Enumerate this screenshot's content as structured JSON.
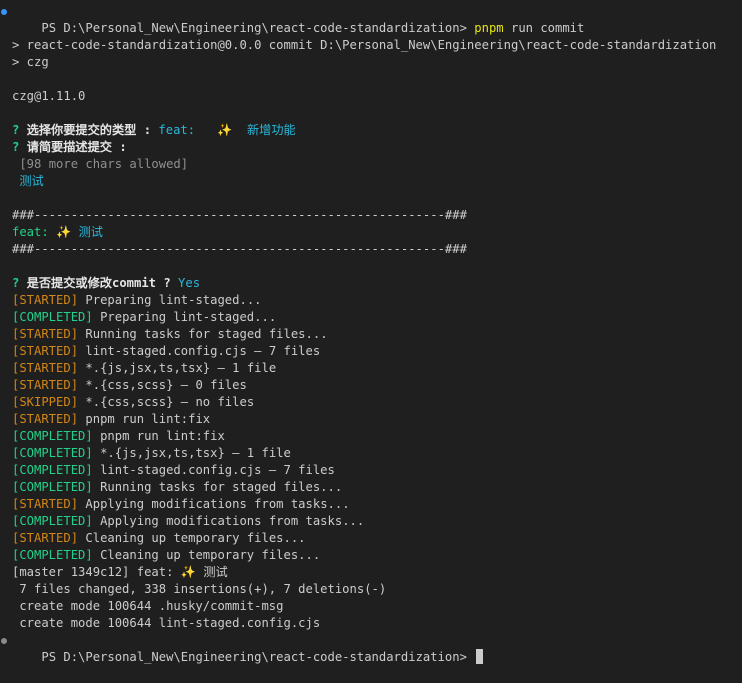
{
  "terminal": {
    "prompt_path": "PS D:\\Personal_New\\Engineering\\react-code-standardization>",
    "command": {
      "tool": "pnpm",
      "args": "run commit"
    },
    "script_header": "> react-code-standardization@0.0.0 commit D:\\Personal_New\\Engineering\\react-code-standardization",
    "script_cmd": "> czg",
    "czg_version": "czg@1.11.0",
    "questions": {
      "type_q": "选择你要提交的类型 :",
      "type_answer_key": "feat:",
      "type_answer_emoji": "✨",
      "type_answer_desc": "新增功能",
      "subject_q": "请简要描述提交 :",
      "chars_hint": "[98 more chars allowed]",
      "subject_answer": "测试",
      "confirm_q": "是否提交或修改commit ?",
      "confirm_answer": "Yes"
    },
    "separator": "###--------------------------------------------------------###",
    "preview_type": "feat:",
    "preview_emoji": "✨",
    "preview_subject": "测试",
    "lint_lines": [
      {
        "tag": "[STARTED]",
        "text": "Preparing lint-staged...",
        "status": "started"
      },
      {
        "tag": "[COMPLETED]",
        "text": "Preparing lint-staged...",
        "status": "completed"
      },
      {
        "tag": "[STARTED]",
        "text": "Running tasks for staged files...",
        "status": "started"
      },
      {
        "tag": "[STARTED]",
        "text": "lint-staged.config.cjs — 7 files",
        "status": "started"
      },
      {
        "tag": "[STARTED]",
        "text": "*.{js,jsx,ts,tsx} — 1 file",
        "status": "started"
      },
      {
        "tag": "[STARTED]",
        "text": "*.{css,scss} — 0 files",
        "status": "started"
      },
      {
        "tag": "[SKIPPED]",
        "text": "*.{css,scss} — no files",
        "status": "skipped"
      },
      {
        "tag": "[STARTED]",
        "text": "pnpm run lint:fix",
        "status": "started"
      },
      {
        "tag": "[COMPLETED]",
        "text": "pnpm run lint:fix",
        "status": "completed"
      },
      {
        "tag": "[COMPLETED]",
        "text": "*.{js,jsx,ts,tsx} — 1 file",
        "status": "completed"
      },
      {
        "tag": "[COMPLETED]",
        "text": "lint-staged.config.cjs — 7 files",
        "status": "completed"
      },
      {
        "tag": "[COMPLETED]",
        "text": "Running tasks for staged files...",
        "status": "completed"
      },
      {
        "tag": "[STARTED]",
        "text": "Applying modifications from tasks...",
        "status": "started"
      },
      {
        "tag": "[COMPLETED]",
        "text": "Applying modifications from tasks...",
        "status": "completed"
      },
      {
        "tag": "[STARTED]",
        "text": "Cleaning up temporary files...",
        "status": "started"
      },
      {
        "tag": "[COMPLETED]",
        "text": "Cleaning up temporary files...",
        "status": "completed"
      }
    ],
    "commit_summary": "[master 1349c12] feat:",
    "commit_emoji": "✨",
    "commit_subject": "测试",
    "stats": " 7 files changed, 338 insertions(+), 7 deletions(-)",
    "create_1": " create mode 100644 .husky/commit-msg",
    "create_2": " create mode 100644 lint-staged.config.cjs",
    "final_prompt": "PS D:\\Personal_New\\Engineering\\react-code-standardization>"
  },
  "colors": {
    "background": "#1f1f1f",
    "started": "#d18616",
    "completed": "#23d18b",
    "skipped": "#d18616",
    "accent": "#3794ff"
  }
}
